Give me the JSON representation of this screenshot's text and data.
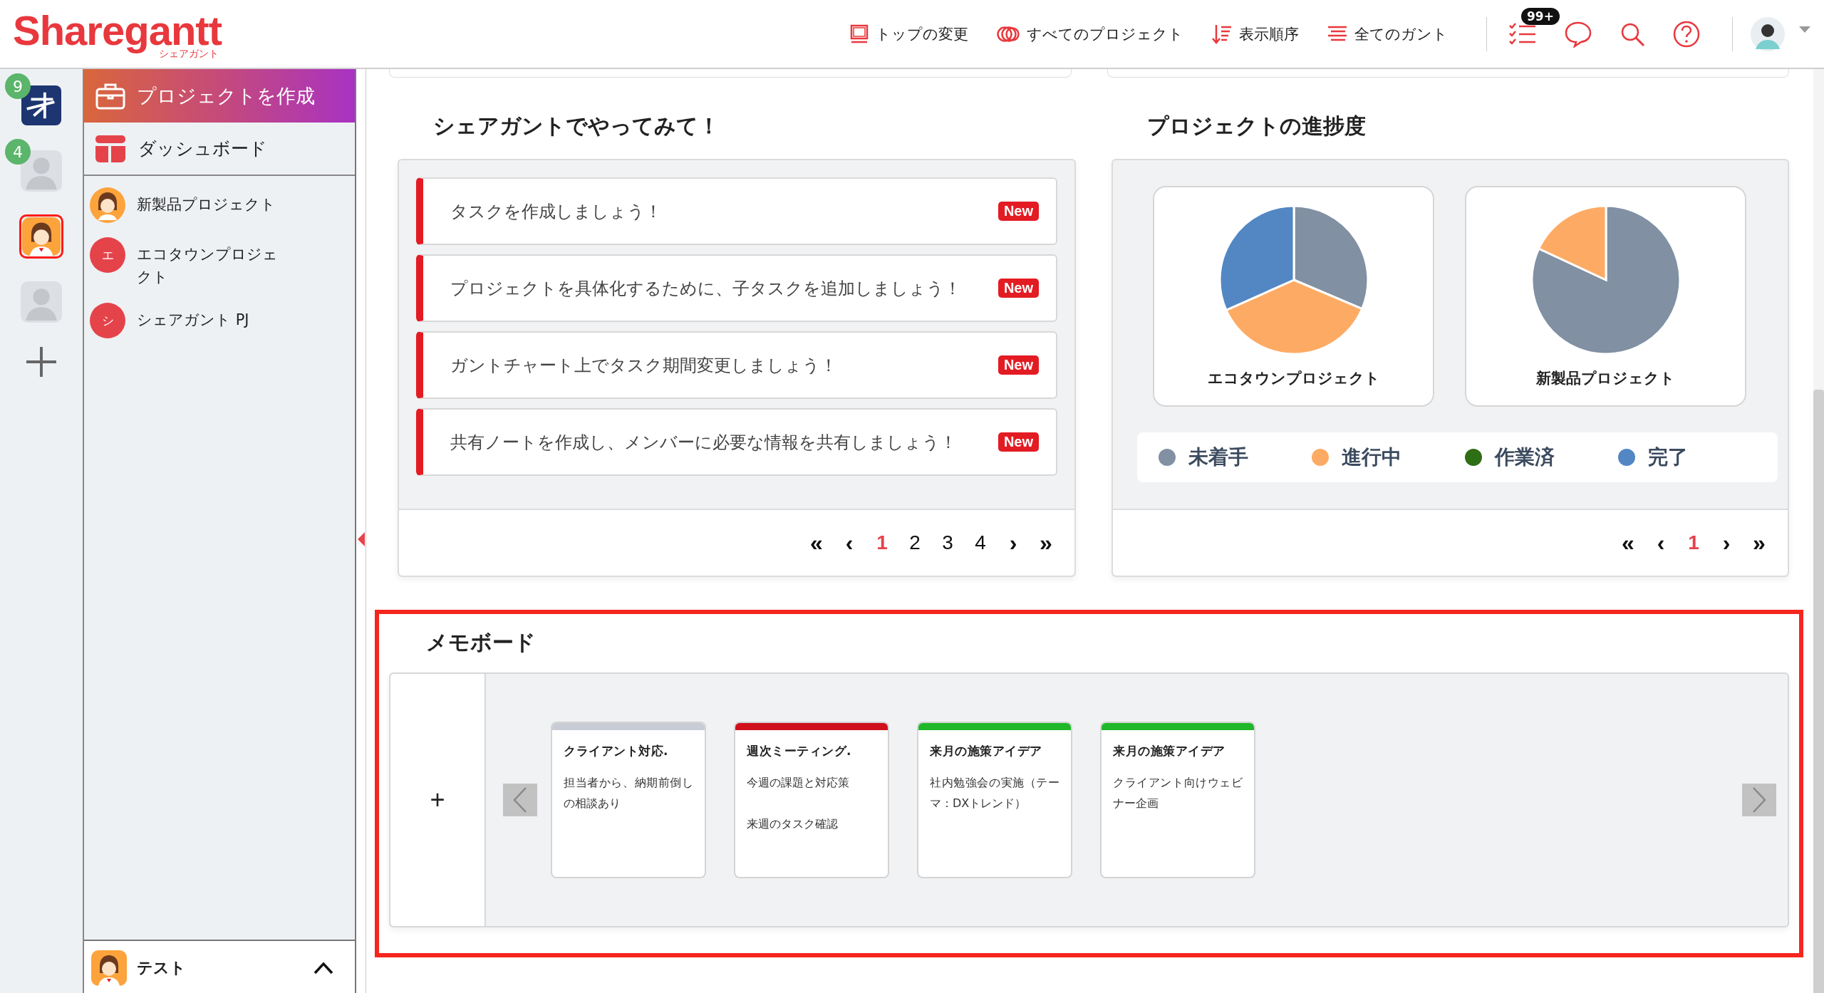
{
  "header": {
    "logo": "Sharegantt",
    "logo_sub": "シェアガント",
    "nav": [
      {
        "label": "トップの変更",
        "kind": "frame"
      },
      {
        "label": "すべてのプロジェクト",
        "kind": "rings"
      },
      {
        "label": "表示順序",
        "kind": "sort"
      },
      {
        "label": "全てのガント",
        "kind": "lines"
      }
    ],
    "notification_badge": "99+"
  },
  "rail": {
    "workspaces": [
      {
        "kind": "app",
        "badge": "9",
        "selected": false
      },
      {
        "kind": "user",
        "badge": "4",
        "selected": false
      },
      {
        "kind": "character",
        "selected": true
      },
      {
        "kind": "user",
        "selected": false
      }
    ]
  },
  "sidebar": {
    "create_button": "プロジェクトを作成",
    "dashboard": "ダッシュボード",
    "projects": [
      {
        "name": "新製品プロジェクト",
        "kind": "character"
      },
      {
        "name": "エコタウンプロジェクト",
        "kind": "initial",
        "initial": "エ"
      },
      {
        "name": "シェアガント PJ",
        "kind": "initial",
        "initial": "シ"
      }
    ],
    "footer": {
      "name": "テスト"
    }
  },
  "try_panel": {
    "title": "シェアガントでやってみて！",
    "items": [
      {
        "text": "タスクを作成しましょう！",
        "badge": "New"
      },
      {
        "text": "プロジェクトを具体化するために、子タスクを追加しましょう！",
        "badge": "New"
      },
      {
        "text": "ガントチャート上でタスク期間変更しましょう！",
        "badge": "New"
      },
      {
        "text": "共有ノートを作成し、メンバーに必要な情報を共有しましょう！",
        "badge": "New"
      }
    ],
    "pagination": {
      "first": "«",
      "prev": "‹",
      "next": "›",
      "last": "»",
      "pages": [
        {
          "label": "1",
          "selected": true
        },
        {
          "label": "2",
          "selected": false
        },
        {
          "label": "3",
          "selected": false
        },
        {
          "label": "4",
          "selected": false
        }
      ]
    }
  },
  "progress_panel": {
    "title": "プロジェクトの進捗度",
    "projects": [
      {
        "name": "エコタウンプロジェクト"
      },
      {
        "name": "新製品プロジェクト"
      }
    ],
    "legend": [
      {
        "label": "未着手",
        "color": "#8190a3"
      },
      {
        "label": "進行中",
        "color": "#fdab64"
      },
      {
        "label": "作業済",
        "color": "#2e6e14"
      },
      {
        "label": "完了",
        "color": "#5287c4"
      }
    ],
    "pagination": {
      "first": "«",
      "prev": "‹",
      "next": "›",
      "last": "»",
      "pages": [
        {
          "label": "1",
          "selected": true
        }
      ]
    }
  },
  "memo_board": {
    "title": "メモボード",
    "add": "+",
    "notes": [
      {
        "title": "クライアント対応.",
        "body": [
          "担当者から、納期前倒しの相談あり"
        ],
        "color": "#c8ccd4"
      },
      {
        "title": "週次ミーティング.",
        "body": [
          "今週の課題と対応策",
          "来週のタスク確認"
        ],
        "color": "#d0101c"
      },
      {
        "title": "来月の施策アイデア",
        "body": [
          "社内勉強会の実施（テーマ：DXトレンド）"
        ],
        "color": "#20b82a"
      },
      {
        "title": "来月の施策アイデア",
        "body": [
          "クライアント向けウェビナー企画"
        ],
        "color": "#20b82a"
      }
    ]
  }
}
